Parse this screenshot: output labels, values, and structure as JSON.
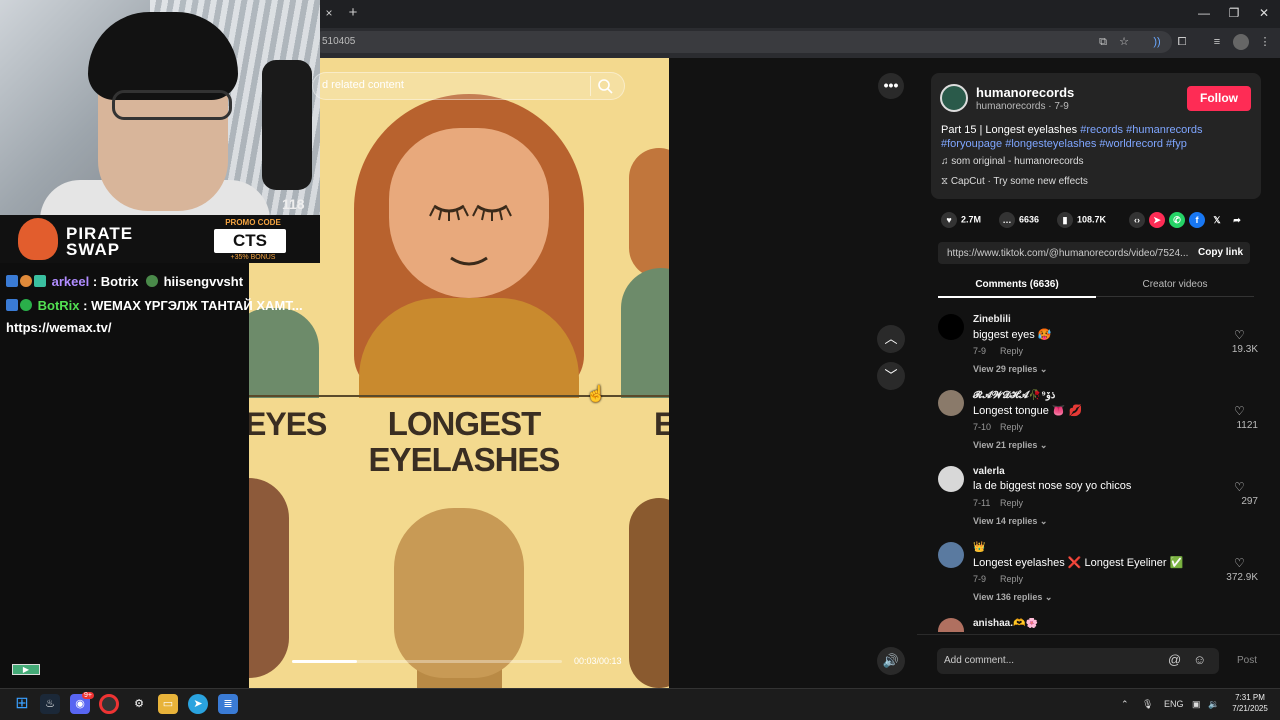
{
  "browser": {
    "url": "510405",
    "tab_close": "×",
    "tab_new": "+"
  },
  "stream": {
    "mic_counter": "118",
    "promo_brand_line1": "PIRATE",
    "promo_brand_line2": "SWAP",
    "promo_label": "PROMO CODE",
    "promo_code": "CTS",
    "promo_bonus": "+35% BONUS"
  },
  "chat": [
    {
      "user": "arkeel",
      "sep": " : ",
      "message": "Botrix",
      "extra": "hiisengvvsht"
    },
    {
      "user": "BotRix",
      "sep": " : ",
      "message": "WEMAX ҮРГЭЛЖ ТАНТАЙ ХАМТ..."
    },
    {
      "message": "https://wemax.tv/"
    }
  ],
  "video": {
    "search_text": "d related content",
    "title_left": "EYES",
    "title_line1": "LONGEST",
    "title_line2": "EYELASHES",
    "title_right": "E",
    "time": "00:03/00:13",
    "progress": 0.24
  },
  "post": {
    "author": "humanorecords",
    "author_sub": "humanorecords · 7-9",
    "follow_label": "Follow",
    "caption_plain": "Part 15 | Longest eyelashes ",
    "tags_line1": "#records #humanrecords",
    "tags_line2": "#foryoupage #longesteyelashes #worldrecord #fyp",
    "music": "som original - humanorecords",
    "capcut": "CapCut · Try some new effects",
    "likes": "2.7M",
    "comments": "6636",
    "saves": "108.7K",
    "link": "https://www.tiktok.com/@humanorecords/video/7524...",
    "copy_link": "Copy link"
  },
  "tabs": {
    "comments": "Comments (6636)",
    "creator": "Creator videos"
  },
  "comments": [
    {
      "name": "Zineblili",
      "text": "biggest eyes 🥵",
      "date": "7-9",
      "reply": "Reply",
      "view": "View 29 replies ⌄",
      "likes": "19.3K",
      "avatar_color": "#000000"
    },
    {
      "name": "𝓡𝓐𝓦𝓓𝓗𝓐🥀ذۆ⁹",
      "text": "Longest tongue 👅 💋",
      "date": "7-10",
      "reply": "Reply",
      "view": "View 21 replies ⌄",
      "likes": "1121",
      "avatar_color": "#8a7a6a"
    },
    {
      "name": "valerla",
      "text": "la de biggest nose soy yo chicos",
      "date": "7-11",
      "reply": "Reply",
      "view": "View 14 replies ⌄",
      "likes": "297",
      "avatar_color": "#d8d8d8"
    },
    {
      "name": "👑",
      "text": "Longest eyelashes ❌ Longest Eyeliner ✅",
      "date": "7-9",
      "reply": "Reply",
      "view": "View 136 replies ⌄",
      "likes": "372.9K",
      "avatar_color": "#5a7aa0"
    },
    {
      "name": "anishaa.🫶🌸",
      "text": "",
      "date": "",
      "reply": "",
      "view": "",
      "likes": "",
      "avatar_color": "#b07060"
    }
  ],
  "composer": {
    "placeholder": "Add comment...",
    "post": "Post"
  },
  "taskbar": {
    "lang": "ENG",
    "time": "7:31 PM",
    "date": "7/21/2025",
    "discord_badge": "9+"
  },
  "colors": {
    "follow": "#fe2c55",
    "hashtag": "#7fa6ff",
    "video_bg": "#f3d98e"
  }
}
